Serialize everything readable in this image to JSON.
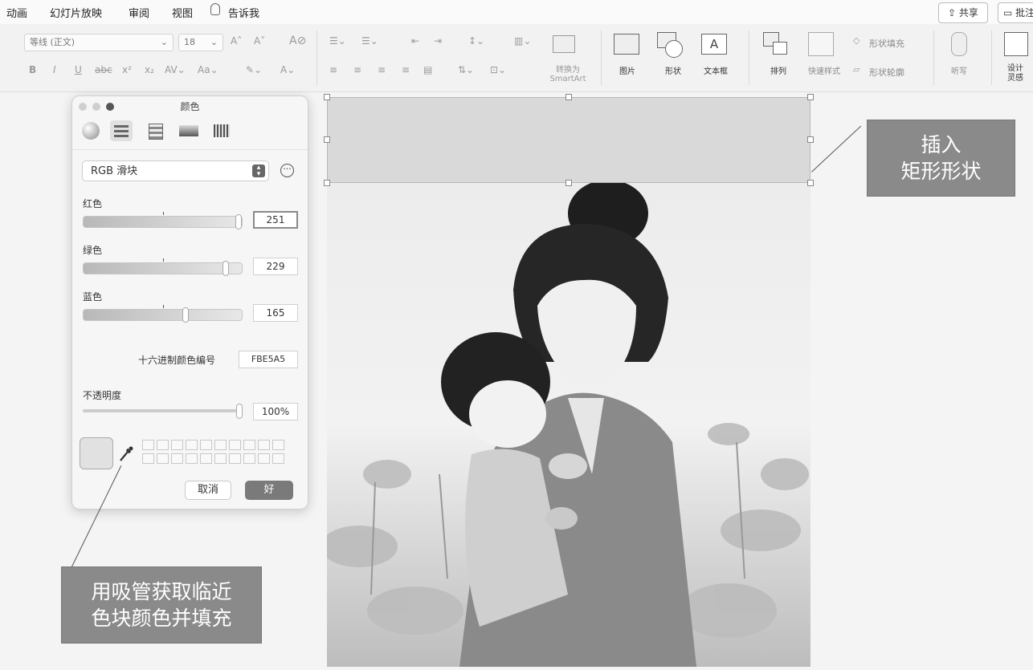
{
  "menu": [
    "动画",
    "幻灯片放映",
    "审阅",
    "视图"
  ],
  "tell_me": "告诉我",
  "share_label": "共享",
  "comment_label": "批注",
  "ribbon": {
    "font_name": "等线 (正文)",
    "font_size": "18",
    "smartart_label": "转换为 SmartArt",
    "picture_label": "图片",
    "shape_label": "形状",
    "textbox_label": "文本框",
    "arrange_label": "排列",
    "quick_styles_label": "快速样式",
    "shape_fill_label": "形状填充",
    "shape_outline_label": "形状轮廓",
    "dictation_label": "听写",
    "designer_label": "设计 灵感"
  },
  "dialog": {
    "title": "颜色",
    "mode": "RGB 滑块",
    "red_label": "红色",
    "red_value": "251",
    "red_fraction": 0.984,
    "green_label": "绿色",
    "green_value": "229",
    "green_fraction": 0.898,
    "blue_label": "蓝色",
    "blue_value": "165",
    "blue_fraction": 0.647,
    "hex_label": "十六进制颜色编号",
    "hex_value": "FBE5A5",
    "opacity_label": "不透明度",
    "opacity_value": "100%",
    "opacity_fraction": 1.0,
    "cancel_label": "取消",
    "ok_label": "好"
  },
  "callouts": {
    "insert_rect": "插入\n矩形形状",
    "eyedropper": "用吸管获取临近\n色块颜色并填充"
  },
  "icons": {
    "tell_me": "lightbulb-icon",
    "share": "share-icon",
    "comment": "comment-icon",
    "eyedropper": "eyedropper-icon"
  }
}
